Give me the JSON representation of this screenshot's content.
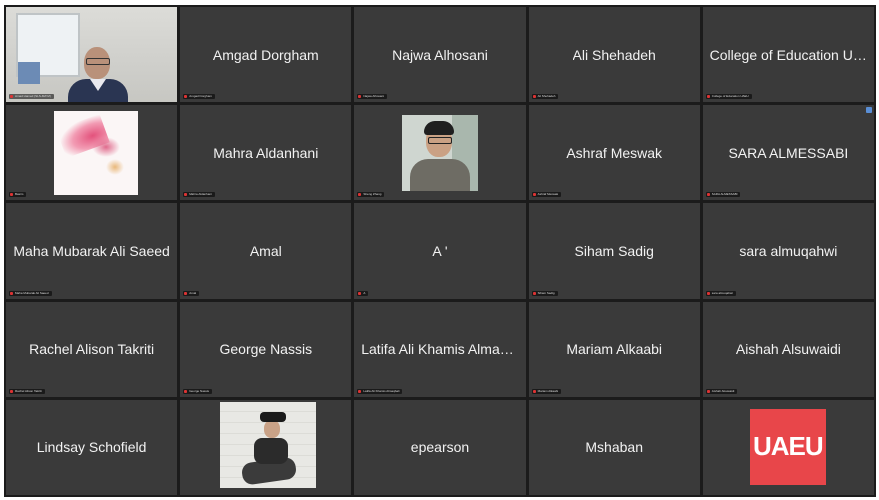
{
  "tiles": [
    {
      "name": "",
      "label": "Amad Hamed (SLS-MAYZ)",
      "video": "self",
      "active": true
    },
    {
      "name": "Amgad Dorgham",
      "label": "Amgad Dorgham"
    },
    {
      "name": "Najwa Alhosani",
      "label": "Najwa Alhosani"
    },
    {
      "name": "Ali Shehadeh",
      "label": "Ali Shehadeh"
    },
    {
      "name": "College of Education UA...",
      "label": "College of Education UAEU"
    },
    {
      "name": "",
      "label": "Basim",
      "video": "flower"
    },
    {
      "name": "Mahra Aldanhani",
      "label": "Mahra Aldanhani"
    },
    {
      "name": "",
      "label": "Sheng Zhang",
      "video": "person"
    },
    {
      "name": "Ashraf Meswak",
      "label": "Ashraf Meswak"
    },
    {
      "name": "SARA ALMESSABI",
      "label": "SARA ALMESSABI",
      "badge": true
    },
    {
      "name": "Maha Mubarak Ali Saeed",
      "label": "Maha Mubarak Ali Saeed"
    },
    {
      "name": "Amal",
      "label": "Amal"
    },
    {
      "name": "A '",
      "label": "A"
    },
    {
      "name": "Siham Sadig",
      "label": "Siham Sadig"
    },
    {
      "name": "sara almuqahwi",
      "label": "sara almuqahwi"
    },
    {
      "name": "Rachel Alison Takriti",
      "label": "Rachel Alison Takriti"
    },
    {
      "name": "George Nassis",
      "label": "George Nassis"
    },
    {
      "name": "Latifa Ali Khamis Almaqb...",
      "label": "Latifa Ali Khamis Almaqbali"
    },
    {
      "name": "Mariam Alkaabi",
      "label": "Mariam Alkaabi"
    },
    {
      "name": "Aishah Alsuwaidi",
      "label": "Aishah Alsuwaidi"
    },
    {
      "name": "Lindsay Schofield",
      "label": ""
    },
    {
      "name": "",
      "label": "",
      "video": "dancer"
    },
    {
      "name": "epearson",
      "label": ""
    },
    {
      "name": "Mshaban",
      "label": ""
    },
    {
      "name": "",
      "label": "",
      "video": "logo",
      "logo_text": "UAEU"
    }
  ],
  "colors": {
    "tile_bg": "#3a3a3a",
    "active_border": "#e8e35a",
    "logo_bg": "#e8464a"
  }
}
